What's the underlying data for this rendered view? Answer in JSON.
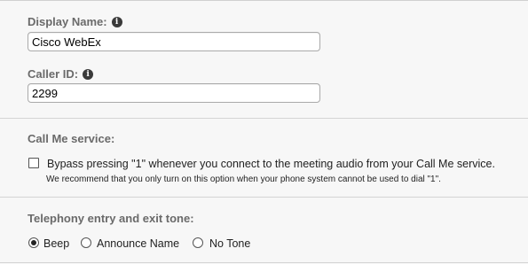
{
  "display_name": {
    "label": "Display Name:",
    "value": "Cisco WebEx",
    "info_icon": "info-icon"
  },
  "caller_id": {
    "label": "Caller ID:",
    "value": "2299",
    "info_icon": "info-icon"
  },
  "call_me_service": {
    "heading": "Call Me service:",
    "checkbox_label": "Bypass pressing \"1\" whenever you connect to the meeting audio from your Call Me service.",
    "checked": false,
    "note": "We recommend that you only turn on this option when your phone system cannot be used to dial \"1\"."
  },
  "telephony_tone": {
    "heading": "Telephony entry and exit tone:",
    "options": [
      {
        "label": "Beep",
        "selected": true
      },
      {
        "label": "Announce Name",
        "selected": false
      },
      {
        "label": "No Tone",
        "selected": false
      }
    ]
  }
}
